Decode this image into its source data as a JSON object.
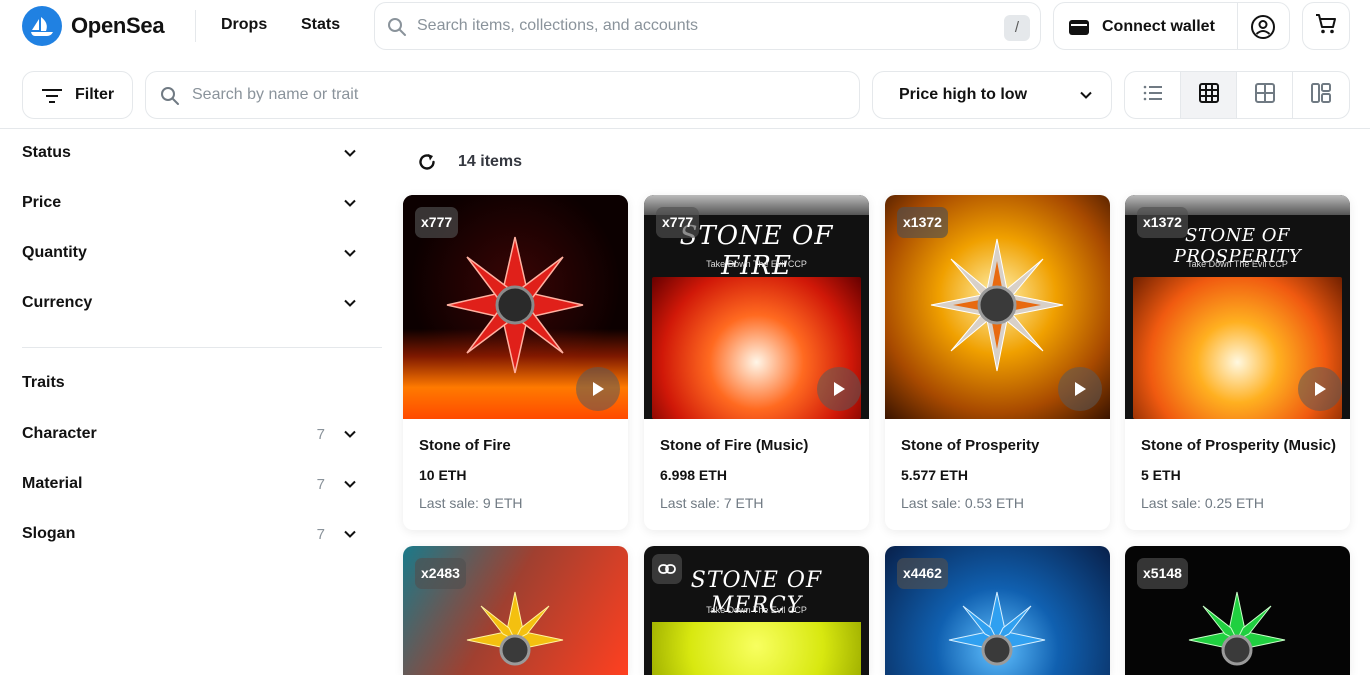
{
  "brand": {
    "name": "OpenSea",
    "color": "#2081e2"
  },
  "nav": {
    "drops": "Drops",
    "stats": "Stats"
  },
  "search": {
    "placeholder": "Search items, collections, and accounts",
    "shortcut": "/"
  },
  "wallet": {
    "label": "Connect wallet"
  },
  "toolbar": {
    "filter_label": "Filter",
    "trait_search_placeholder": "Search by name or trait",
    "sort_value": "Price high to low",
    "active_view": "grid"
  },
  "sidebar": {
    "filters": [
      {
        "label": "Status"
      },
      {
        "label": "Price"
      },
      {
        "label": "Quantity"
      },
      {
        "label": "Currency"
      }
    ],
    "traits_heading": "Traits",
    "traits": [
      {
        "label": "Character",
        "count": "7"
      },
      {
        "label": "Material",
        "count": "7"
      },
      {
        "label": "Slogan",
        "count": "7"
      }
    ]
  },
  "results": {
    "count_label": "14 items"
  },
  "cards": [
    {
      "badge": "x777",
      "name": "Stone of Fire",
      "price": "10 ETH",
      "last_sale": "Last sale: 9 ETH",
      "has_play": true
    },
    {
      "badge": "x777",
      "name": "Stone of Fire (Music)",
      "price": "6.998 ETH",
      "last_sale": "Last sale: 7 ETH",
      "has_play": true,
      "art_title": "STONE OF FIRE",
      "art_sub": "Take Down The Evil CCP"
    },
    {
      "badge": "x1372",
      "name": "Stone of Prosperity",
      "price": "5.577 ETH",
      "last_sale": "Last sale: 0.53 ETH",
      "has_play": true
    },
    {
      "badge": "x1372",
      "name": "Stone of Prosperity (Music)",
      "price": "5 ETH",
      "last_sale": "Last sale: 0.25 ETH",
      "has_play": true,
      "art_title": "STONE OF PROSPERITY",
      "art_sub": "Take Down The Evil CCP"
    },
    {
      "badge": "x2483"
    },
    {
      "badge": "",
      "art_title": "STONE OF MERCY",
      "art_sub": "Take Down The Evil CCP"
    },
    {
      "badge": "x4462"
    },
    {
      "badge": "x5148"
    }
  ]
}
